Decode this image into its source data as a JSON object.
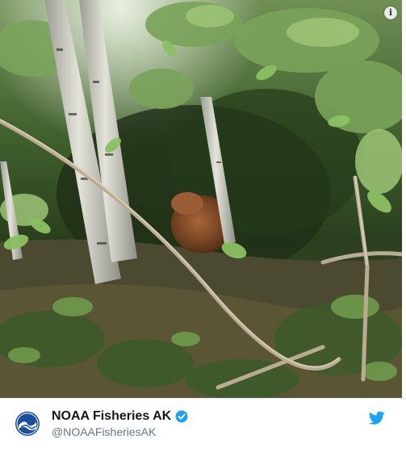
{
  "photo": {
    "alt_icon": "info-icon",
    "content": "forest-scene-with-brown-bear"
  },
  "author": {
    "display_name": "NOAA Fisheries AK",
    "handle": "@NOAAFisheriesAK",
    "verified": true,
    "avatar_icon": "noaa-logo-icon"
  },
  "brand": {
    "icon": "twitter-bird-icon",
    "color": "#1da1f2"
  },
  "colors": {
    "verified_badge": "#1da1f2",
    "name": "#14171a",
    "handle": "#657786",
    "noaa_blue": "#1b4f9c"
  },
  "info_glyph": "i"
}
